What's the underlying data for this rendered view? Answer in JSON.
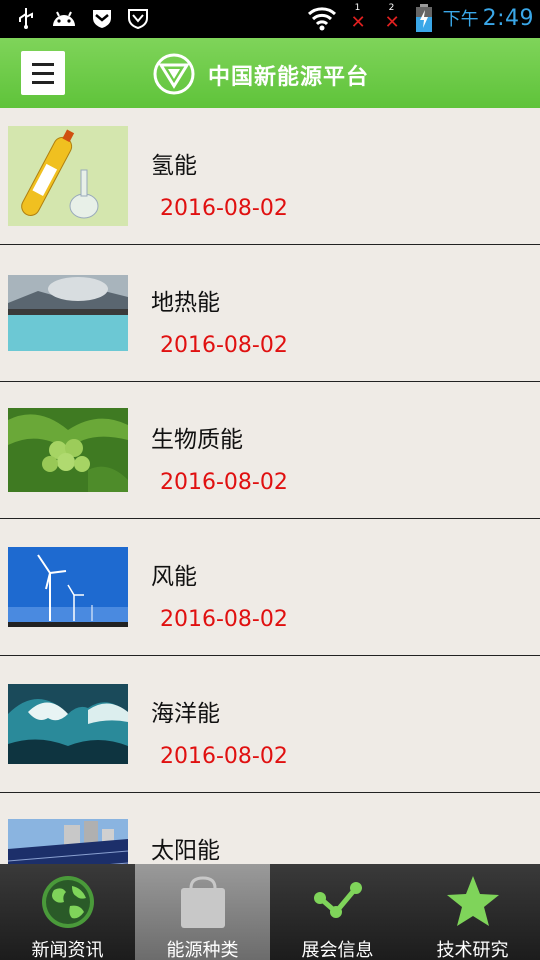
{
  "status_bar": {
    "ampm": "下午",
    "time": "2:49",
    "sim1": "1",
    "sim2": "2",
    "icons": [
      "usb-icon",
      "android-icon",
      "shield-icon",
      "vpn-shield-icon",
      "wifi-icon",
      "signal-icon",
      "battery-charging-icon"
    ]
  },
  "header": {
    "title": "中国新能源平台",
    "menu_icon": "hamburger-menu-icon",
    "logo_icon": "platform-logo-icon",
    "accent": "#6ccb45"
  },
  "list": {
    "items": [
      {
        "title": "氢能",
        "date": "2016-08-02",
        "thumb": "hydrogen-cylinder-thumb"
      },
      {
        "title": "地热能",
        "date": "2016-08-02",
        "thumb": "geothermal-lake-thumb"
      },
      {
        "title": "生物质能",
        "date": "2016-08-02",
        "thumb": "green-fruit-plant-thumb"
      },
      {
        "title": "风能",
        "date": "2016-08-02",
        "thumb": "wind-turbines-thumb"
      },
      {
        "title": "海洋能",
        "date": "2016-08-02",
        "thumb": "ocean-wave-thumb"
      },
      {
        "title": "太阳能",
        "date": "",
        "thumb": "solar-panels-thumb"
      }
    ],
    "date_color": "#e01010"
  },
  "bottom_nav": {
    "items": [
      {
        "label": "新闻资讯",
        "icon": "globe-icon"
      },
      {
        "label": "能源种类",
        "icon": "shopping-bag-icon"
      },
      {
        "label": "展会信息",
        "icon": "share-network-icon"
      },
      {
        "label": "技术研究",
        "icon": "star-icon"
      }
    ],
    "active_index": 1
  }
}
